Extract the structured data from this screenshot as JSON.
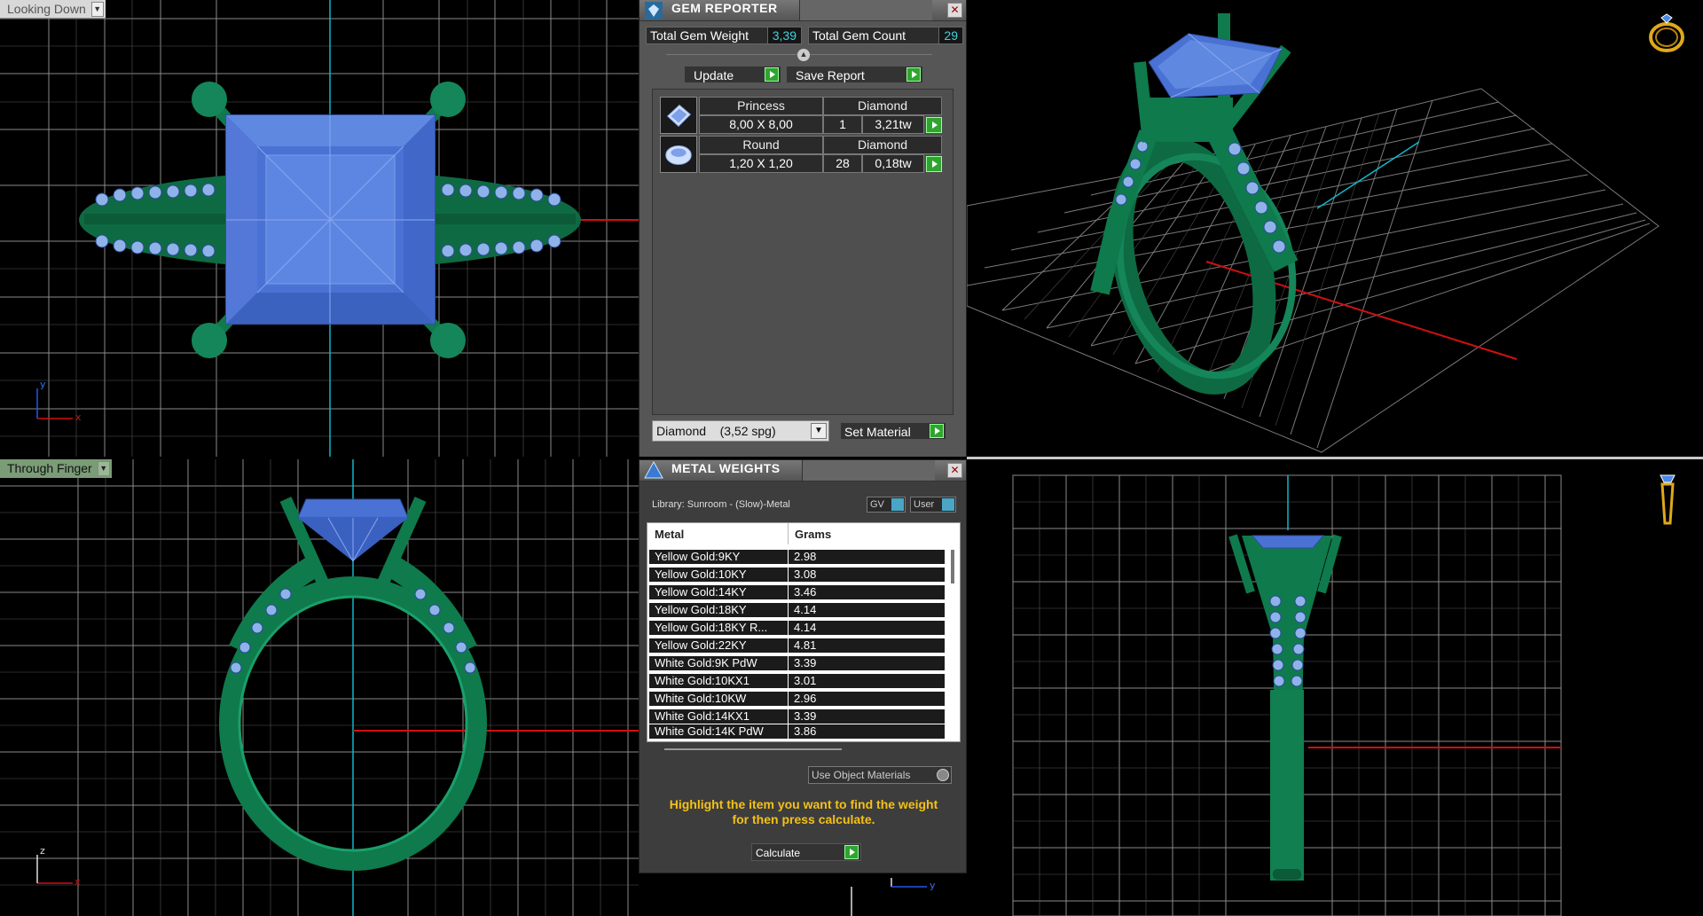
{
  "viewports": {
    "top": {
      "label": "Looking Down"
    },
    "front": {
      "label": "Through Finger"
    }
  },
  "gem_reporter": {
    "title": "GEM REPORTER",
    "total_weight_label": "Total Gem Weight",
    "total_weight_value": "3,39",
    "total_count_label": "Total Gem Count",
    "total_count_value": "29",
    "update_label": "Update",
    "save_report_label": "Save Report",
    "gems": [
      {
        "shape": "Princess",
        "type": "Diamond",
        "size": "8,00 X 8,00",
        "count": "1",
        "weight": "3,21tw"
      },
      {
        "shape": "Round",
        "type": "Diamond",
        "size": "1,20 X 1,20",
        "count": "28",
        "weight": "0,18tw"
      }
    ],
    "material_select": "Diamond    (3,52 spg)",
    "set_material_label": "Set Material"
  },
  "metal_weights": {
    "title": "METAL WEIGHTS",
    "library": "Library: Sunroom - (Slow)-Metal",
    "gv_label": "GV",
    "user_label": "User",
    "columns": [
      "Metal",
      "Grams"
    ],
    "rows": [
      [
        "Yellow Gold:9KY",
        "2.98"
      ],
      [
        "Yellow Gold:10KY",
        "3.08"
      ],
      [
        "Yellow Gold:14KY",
        "3.46"
      ],
      [
        "Yellow Gold:18KY",
        "4.14"
      ],
      [
        "Yellow Gold:18KY R...",
        "4.14"
      ],
      [
        "Yellow Gold:22KY",
        "4.81"
      ],
      [
        "White Gold:9K PdW",
        "3.39"
      ],
      [
        "White Gold:10KX1",
        "3.01"
      ],
      [
        "White Gold:10KW",
        "2.96"
      ],
      [
        "White Gold:14KX1",
        "3.39"
      ],
      [
        "White Gold:14K PdW",
        "3.86"
      ]
    ],
    "use_object_materials": "Use Object Materials",
    "message_line1": "Highlight the item you want to find the weight",
    "message_line2": "for then press calculate.",
    "calculate_label": "Calculate"
  },
  "axes": {
    "x": "x",
    "y": "y",
    "z": "z"
  },
  "colors": {
    "metal": "#0f7a4c",
    "gem": "#4a72d4",
    "grid": "#9a9a9a",
    "axis_x": "#d01010",
    "axis_y": "#10b8c8"
  },
  "icons": [
    "ring-icon",
    "ring-side-icon",
    "gem-reporter-icon",
    "metal-weights-icon",
    "princess-gem-icon",
    "round-gem-icon",
    "close-icon"
  ]
}
